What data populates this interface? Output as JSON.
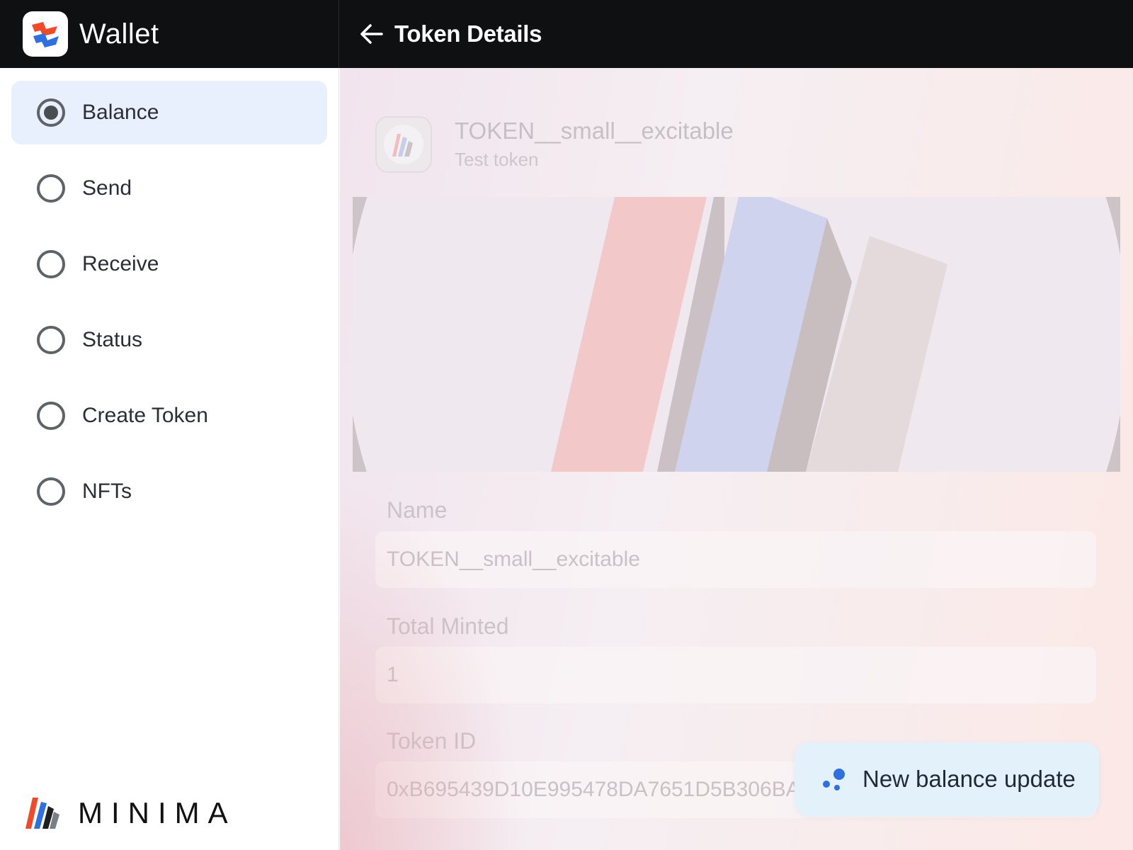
{
  "header": {
    "app_title": "Wallet",
    "page_title": "Token Details"
  },
  "sidebar": {
    "items": [
      {
        "label": "Balance",
        "selected": true
      },
      {
        "label": "Send",
        "selected": false
      },
      {
        "label": "Receive",
        "selected": false
      },
      {
        "label": "Status",
        "selected": false
      },
      {
        "label": "Create Token",
        "selected": false
      },
      {
        "label": "NFTs",
        "selected": false
      }
    ],
    "brand": "MINIMA"
  },
  "token": {
    "name": "TOKEN__small__excitable",
    "description": "Test token",
    "fields": [
      {
        "label": "Name",
        "value": "TOKEN__small__excitable"
      },
      {
        "label": "Total Minted",
        "value": "1"
      },
      {
        "label": "Token ID",
        "value": "0xB695439D10E995478DA7651D5B306BA9"
      }
    ]
  },
  "toast": {
    "message": "New balance update"
  },
  "colors": {
    "topbar": "#0f1012",
    "active_nav": "#e8f0fd",
    "toast_bg": "#e3f1fb",
    "accent_blue": "#2f6fe0",
    "accent_red": "#f04a2a"
  },
  "icons": {
    "app": "wallet-logo-icon",
    "back": "arrow-left-icon",
    "toast": "dots-loading-icon",
    "brand": "minima-logo-icon"
  }
}
